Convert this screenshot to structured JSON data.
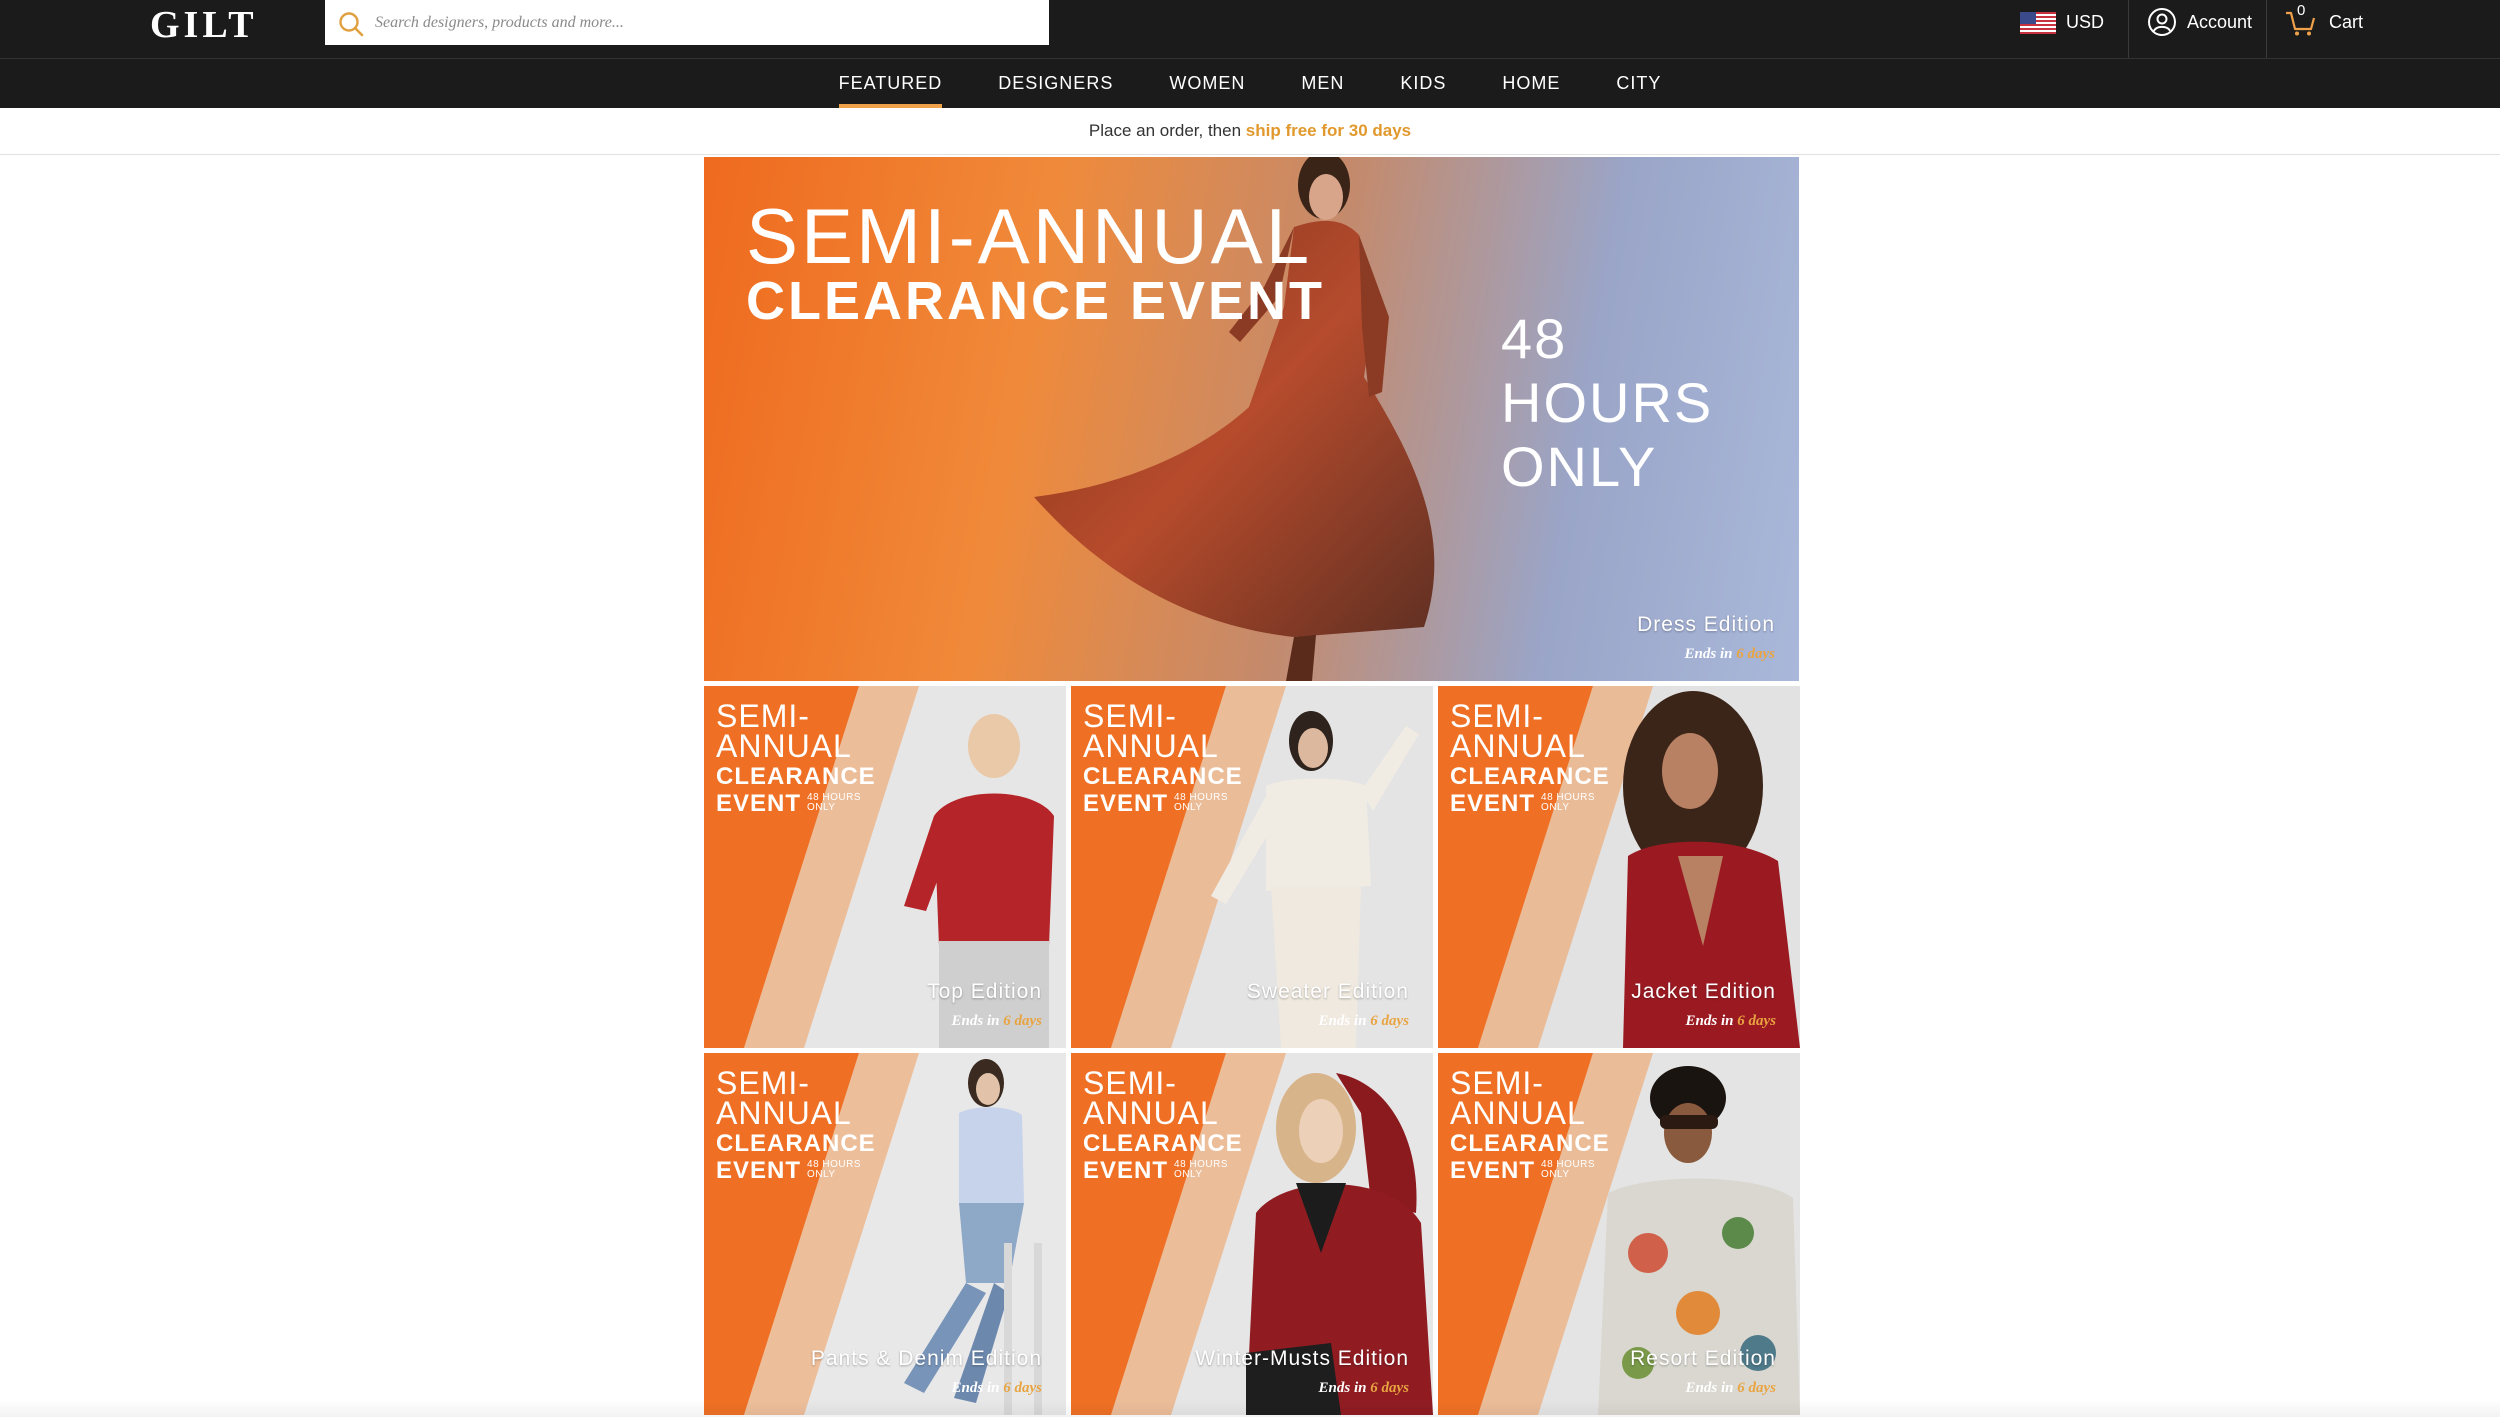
{
  "header": {
    "logo": "GILT",
    "search_placeholder": "Search designers, products and more...",
    "currency": "USD",
    "account": "Account",
    "cart_label": "Cart",
    "cart_count": "0"
  },
  "nav": {
    "items": [
      {
        "label": "FEATURED",
        "active": true
      },
      {
        "label": "DESIGNERS",
        "active": false
      },
      {
        "label": "WOMEN",
        "active": false
      },
      {
        "label": "MEN",
        "active": false
      },
      {
        "label": "KIDS",
        "active": false
      },
      {
        "label": "HOME",
        "active": false
      },
      {
        "label": "CITY",
        "active": false
      }
    ]
  },
  "promo": {
    "text": "Place an order, then",
    "link": "ship free for 30 days"
  },
  "hero": {
    "line1": "SEMI-ANNUAL",
    "line2": "CLEARANCE EVENT",
    "side_line1": "48 HOURS",
    "side_line2": "ONLY",
    "edition": "Dress Edition",
    "ends_prefix": "Ends in",
    "ends_days": "6 days"
  },
  "tile_badge": {
    "semi1": "SEMI-",
    "semi2": "ANNUAL",
    "clearance": "CLEARANCE",
    "event": "EVENT",
    "hours1": "48 HOURS",
    "hours2": "ONLY"
  },
  "tiles": [
    {
      "edition": "Top Edition",
      "ends_prefix": "Ends in",
      "ends_days": "6 days"
    },
    {
      "edition": "Sweater Edition",
      "ends_prefix": "Ends in",
      "ends_days": "6 days"
    },
    {
      "edition": "Jacket Edition",
      "ends_prefix": "Ends in",
      "ends_days": "6 days"
    },
    {
      "edition": "Pants & Denim Edition",
      "ends_prefix": "Ends in",
      "ends_days": "6 days"
    },
    {
      "edition": "Winter-Musts Edition",
      "ends_prefix": "Ends in",
      "ends_days": "6 days"
    },
    {
      "edition": "Resort Edition",
      "ends_prefix": "Ends in",
      "ends_days": "6 days"
    }
  ],
  "colors": {
    "accent": "#f0a24b",
    "promo_link": "#e1992d",
    "header_bg": "#1b1b1b",
    "orange": "#ef6a1e"
  }
}
